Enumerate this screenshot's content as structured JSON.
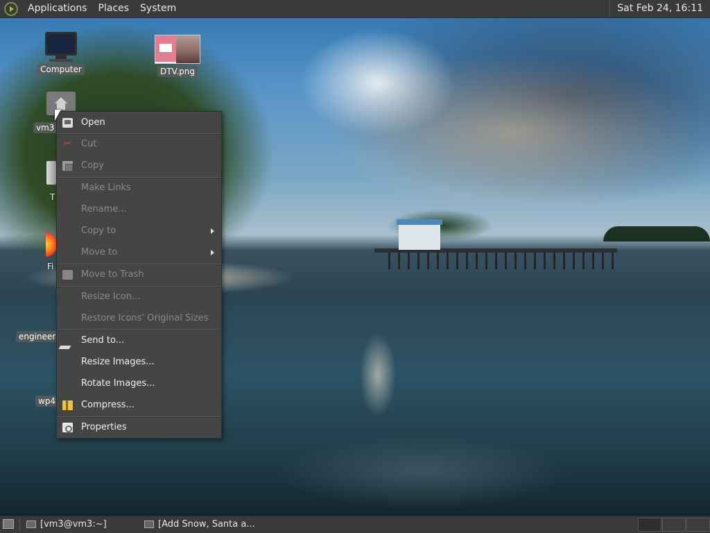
{
  "top_panel": {
    "menus": [
      "Applications",
      "Places",
      "System"
    ],
    "clock": "Sat Feb 24, 16:11"
  },
  "desktop": {
    "icons": {
      "computer": "Computer",
      "image": "DTV.png",
      "home_partial": "vm3",
      "trash_partial": "T",
      "firefox_partial": "Fi",
      "engineer_partial": "engineer",
      "wp_partial": "wp4"
    }
  },
  "context_menu": {
    "items": [
      {
        "label": "Open",
        "icon": "open-icon",
        "enabled": true
      },
      {
        "label": "Cut",
        "icon": "scissors-icon",
        "enabled": false
      },
      {
        "label": "Copy",
        "icon": "copy-icon",
        "enabled": false
      },
      {
        "label": "Make Links",
        "enabled": false
      },
      {
        "label": "Rename...",
        "enabled": false
      },
      {
        "label": "Copy to",
        "enabled": false,
        "submenu": true
      },
      {
        "label": "Move to",
        "enabled": false,
        "submenu": true
      },
      {
        "label": "Move to Trash",
        "icon": "trash-icon",
        "enabled": false
      },
      {
        "label": "Resize Icon...",
        "enabled": false
      },
      {
        "label": "Restore Icons' Original Sizes",
        "enabled": false
      },
      {
        "label": "Send to...",
        "icon": "send-icon",
        "enabled": true
      },
      {
        "label": "Resize Images...",
        "enabled": true
      },
      {
        "label": "Rotate Images...",
        "enabled": true
      },
      {
        "label": "Compress...",
        "icon": "archive-icon",
        "enabled": true
      },
      {
        "label": "Properties",
        "icon": "properties-icon",
        "enabled": true
      }
    ]
  },
  "bottom_panel": {
    "tasks": [
      "[vm3@vm3:~]",
      "[Add Snow, Santa a..."
    ]
  }
}
